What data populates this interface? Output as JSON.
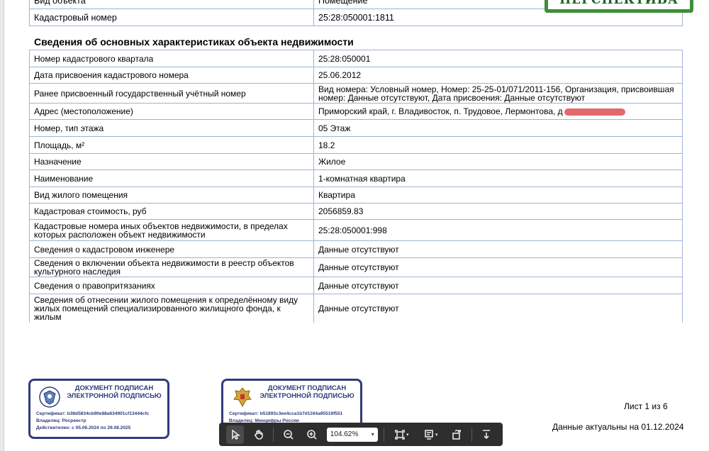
{
  "top_rows": [
    {
      "label": "Вид объекта",
      "value": "Помещение"
    },
    {
      "label": "Кадастровый номер",
      "value": "25:28:050001:1811"
    }
  ],
  "logo_text": "ПЕРСПЕКТИВА",
  "section_title": "Сведения об основных характеристиках объекта недвижимости",
  "rows": [
    {
      "label": "Номер кадастрового квартала",
      "value": "25:28:050001"
    },
    {
      "label": "Дата присвоения кадастрового номера",
      "value": "25.06.2012"
    },
    {
      "label": "Ранее присвоенный государственный учётный номер",
      "value": "Вид номера: Условный номер, Номер: 25-25-01/071/2011-156, Организация, присвоившая номер: Данные отсутствуют, Дата присвоения: Данные отсутствуют"
    },
    {
      "label": "Адрес (местоположение)",
      "value": "Приморский край, г. Владивосток, п. Трудовое, Лермонтова, д"
    },
    {
      "label": "Номер, тип этажа",
      "value": "05 Этаж"
    },
    {
      "label": "Площадь, м²",
      "value": "18.2"
    },
    {
      "label": "Назначение",
      "value": "Жилое"
    },
    {
      "label": "Наименование",
      "value": "1-комнатная квартира"
    },
    {
      "label": "Вид жилого помещения",
      "value": "Квартира"
    },
    {
      "label": "Кадастровая стоимость, руб",
      "value": "2056859.83"
    },
    {
      "label": "Кадастровые номера иных объектов недвижимости, в пределах которых расположен объект недвижимости",
      "value": "25:28:050001:998"
    },
    {
      "label": "Сведения о кадастровом инженере",
      "value": "Данные отсутствуют"
    },
    {
      "label": "Сведения о включении объекта недвижимости в реестр объектов культурного наследия",
      "value": "Данные отсутствуют"
    },
    {
      "label": "Сведения о правопритязаниях",
      "value": "Данные отсутствуют"
    },
    {
      "label": "Сведения об отнесении жилого помещения к определённому виду жилых помещений специализированного жилищного фонда, к жилым",
      "value": "Данные отсутствуют"
    }
  ],
  "stamps": [
    {
      "title": "ДОКУМЕНТ ПОДПИСАН ЭЛЕКТРОННОЙ ПОДПИСЬЮ",
      "certificate": "Сертификат: b38d5834cb90e88a634901cf13444cfc",
      "owner": "Владелец: Росреестр",
      "valid": "Действителен: с 05.06.2024 по 29.08.2025"
    },
    {
      "title": "ДОКУМЕНТ ПОДПИСАН ЭЛЕКТРОННОЙ ПОДПИСЬЮ",
      "certificate": "Сертификат: b51893c3ee4cca1b7d1164a95519f551",
      "owner": "Владелец: Минцифры России",
      "valid": ""
    }
  ],
  "page_number": "Лист 1 из 6",
  "actual_date": "Данные актуальны на 01.12.2024",
  "toolbar": {
    "zoom": "104.62%",
    "tools": [
      "select-tool",
      "hand-tool",
      "zoom-out",
      "zoom-in",
      "fit-page",
      "page-view",
      "rotate",
      "download"
    ]
  }
}
